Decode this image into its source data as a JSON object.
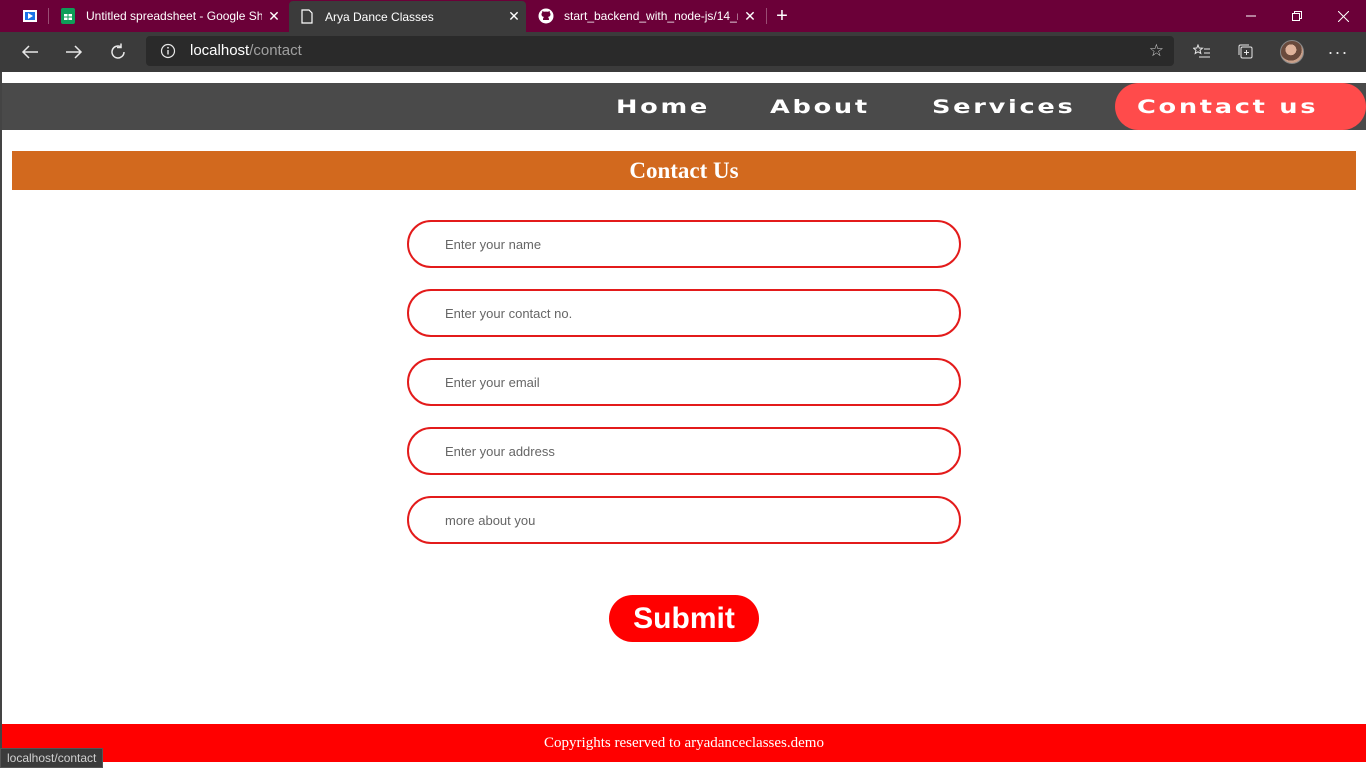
{
  "browser": {
    "tabs": [
      {
        "title": "Untitled spreadsheet - Google Sh",
        "icon": "google-sheets-icon",
        "active": false
      },
      {
        "title": "Arya Dance Classes",
        "icon": "page-icon",
        "active": true
      },
      {
        "title": "start_backend_with_node-js/14_r",
        "icon": "github-icon",
        "active": false
      }
    ],
    "url_host": "localhost",
    "url_path": "/contact",
    "status_text": "localhost/contact"
  },
  "nav": {
    "items": [
      "Home",
      "About",
      "Services",
      "Contact us"
    ],
    "active_index": 3
  },
  "page": {
    "heading": "Contact Us",
    "form": {
      "name_placeholder": "Enter your name",
      "phone_placeholder": "Enter your contact no.",
      "email_placeholder": "Enter your email",
      "address_placeholder": "Enter your address",
      "about_placeholder": "more about you",
      "submit_label": "Submit"
    },
    "footer": "Copyrights reserved to aryadanceclasses.demo"
  },
  "colors": {
    "titlebar": "#6b0038",
    "navbar": "#4a4a4a",
    "nav_active": "#ff4b4b",
    "heading_bg": "#d2691e",
    "field_border": "#e31b1b",
    "submit_bg": "#ff0000",
    "footer_bg": "#ff0000"
  }
}
